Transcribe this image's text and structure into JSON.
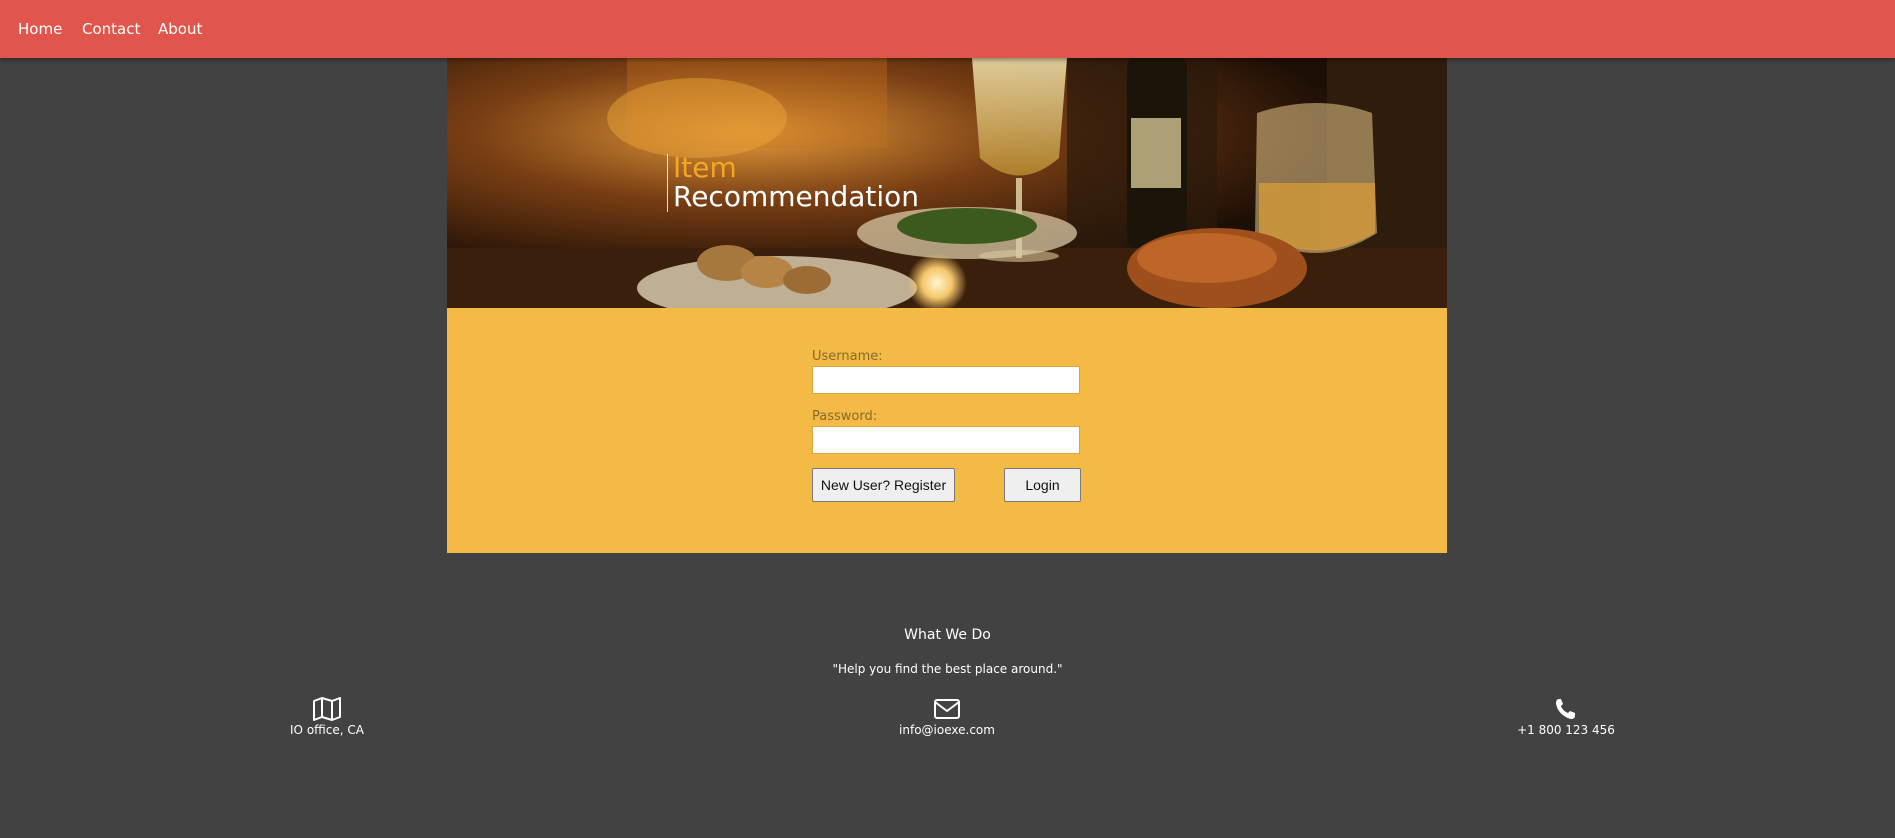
{
  "nav": {
    "links": [
      {
        "label": "Home"
      },
      {
        "label": "Contact"
      },
      {
        "label": "About"
      }
    ]
  },
  "hero": {
    "title_line1": "Item",
    "title_line2": "Recommendation"
  },
  "login": {
    "username_label": "Username:",
    "username_value": "",
    "password_label": "Password:",
    "password_value": "",
    "register_button": "New User? Register",
    "login_button": "Login"
  },
  "footer": {
    "title": "What We Do",
    "tagline": "\"Help you find the best place around.\"",
    "contacts": [
      {
        "icon": "map-icon",
        "text": "IO office, CA"
      },
      {
        "icon": "envelope-icon",
        "text": "info@ioexe.com"
      },
      {
        "icon": "phone-icon",
        "text": "+1 800 123 456"
      }
    ]
  },
  "colors": {
    "nav_bg": "#e0564c",
    "page_bg": "#424242",
    "panel_bg": "#f3ba45",
    "brand_accent": "#f5a623"
  }
}
